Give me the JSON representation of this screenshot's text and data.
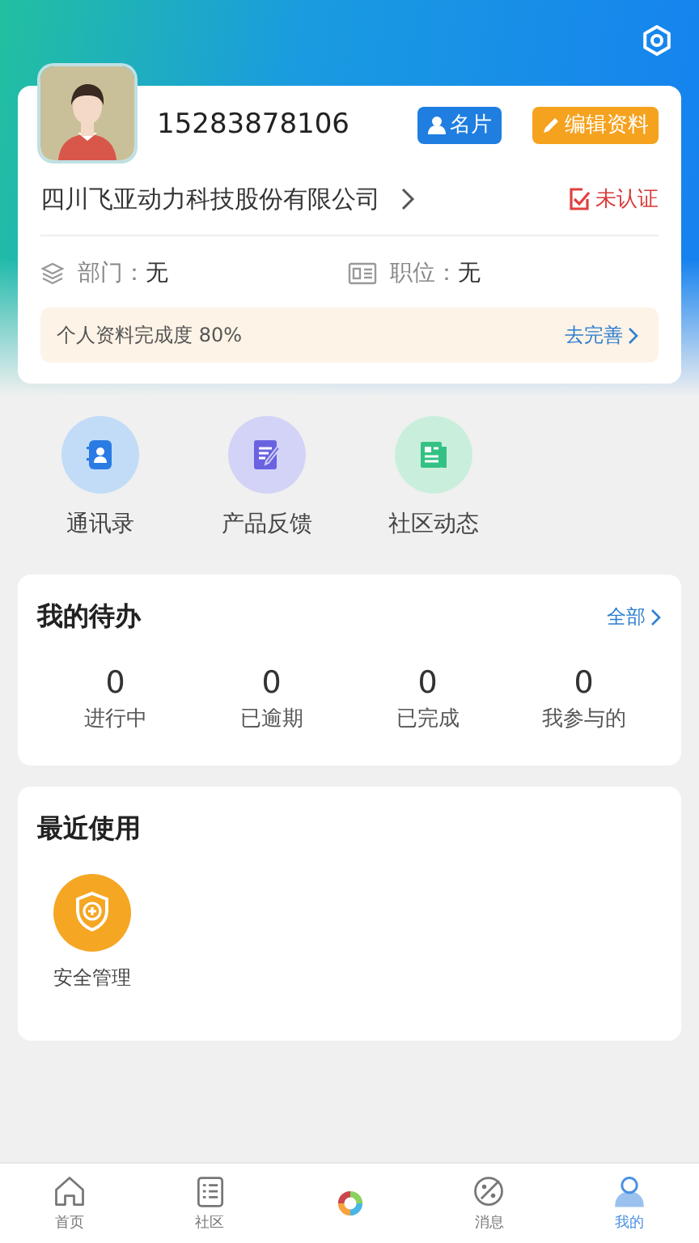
{
  "profile": {
    "phone": "15283878106",
    "buttons": [
      {
        "label": "名片",
        "kind": "card"
      },
      {
        "label": "编辑资料",
        "kind": "edit"
      }
    ],
    "company": "四川飞亚动力科技股份有限公司",
    "verification": "未认证",
    "fields": [
      {
        "label": "部门：",
        "value": "无",
        "kind": "department"
      },
      {
        "label": "职位：",
        "value": "无",
        "kind": "position"
      }
    ],
    "completion": {
      "text": "个人资料完成度 80%",
      "action": "去完善"
    }
  },
  "shortcuts": [
    {
      "label": "通讯录",
      "kind": "contacts"
    },
    {
      "label": "产品反馈",
      "kind": "feedback"
    },
    {
      "label": "社区动态",
      "kind": "news"
    }
  ],
  "todo": {
    "title": "我的待办",
    "more": "全部",
    "stats": [
      {
        "count": "0",
        "label": "进行中"
      },
      {
        "count": "0",
        "label": "已逾期"
      },
      {
        "count": "0",
        "label": "已完成"
      },
      {
        "count": "0",
        "label": "我参与的"
      }
    ]
  },
  "recent": {
    "title": "最近使用",
    "items": [
      {
        "label": "安全管理",
        "kind": "shield"
      }
    ]
  },
  "nav": [
    {
      "label": "首页",
      "kind": "home",
      "selected": false
    },
    {
      "label": "社区",
      "kind": "community",
      "selected": false
    },
    {
      "kind": "logo",
      "selected": false
    },
    {
      "label": "消息",
      "kind": "message",
      "selected": false
    },
    {
      "label": "我的",
      "kind": "me",
      "selected": true
    }
  ]
}
